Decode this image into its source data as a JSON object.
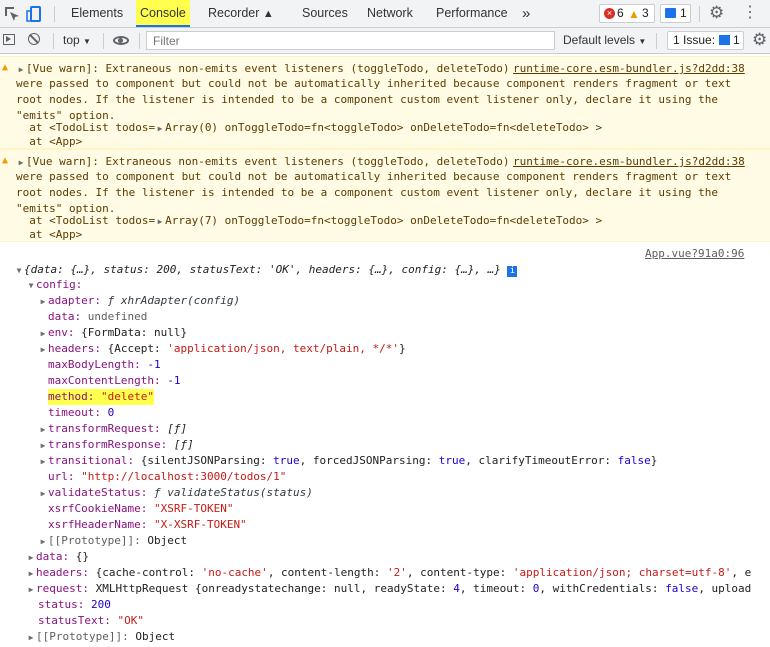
{
  "tabs": {
    "elements": "Elements",
    "console": "Console",
    "recorder": "Recorder",
    "sources": "Sources",
    "network": "Network",
    "performance": "Performance",
    "more": "»"
  },
  "counts": {
    "errors": "6",
    "warnings": "3",
    "messages": "1"
  },
  "toolbar": {
    "context": "top",
    "filter_placeholder": "Filter",
    "levels": "Default levels",
    "issues_label": "1 Issue:",
    "issues_count": "1"
  },
  "warnings": [
    {
      "text": "[Vue warn]: Extraneous non-emits event listeners (toggleTodo, deleteTodo)",
      "link": "runtime-core.esm-bundler.js?d2dd:38",
      "body": "were passed to component but could not be automatically inherited because component renders fragment or text\nroot nodes. If the listener is intended to be a component custom event listener only, declare it using the\n\"emits\" option.",
      "at1_pre": "  at <TodoList todos=",
      "at1_arr": "Array(0)",
      "at1_post": " onToggleTodo=fn<toggleTodo> onDeleteTodo=fn<deleteTodo> >",
      "at2": "  at <App>"
    },
    {
      "text": "[Vue warn]: Extraneous non-emits event listeners (toggleTodo, deleteTodo)",
      "link": "runtime-core.esm-bundler.js?d2dd:38",
      "body": "were passed to component but could not be automatically inherited because component renders fragment or text\nroot nodes. If the listener is intended to be a component custom event listener only, declare it using the\n\"emits\" option.",
      "at1_pre": "  at <TodoList todos=",
      "at1_arr": "Array(7)",
      "at1_post": " onToggleTodo=fn<toggleTodo> onDeleteTodo=fn<deleteTodo> >",
      "at2": "  at <App>"
    }
  ],
  "log": {
    "source": "App.vue?91a0:96",
    "summary": "{data: {…}, status: 200, statusText: 'OK', headers: {…}, config: {…}, …}",
    "info_icon": "i",
    "config_key": "config:",
    "adapter_k": "adapter:",
    "adapter_v": "ƒ xhrAdapter(config)",
    "data_k": "data:",
    "data_v": "undefined",
    "env_k": "env:",
    "env_v": "{FormData: null}",
    "headers_k": "headers:",
    "headers_v1": "{Accept: ",
    "headers_v2": "'application/json, text/plain, */*'",
    "headers_v3": "}",
    "maxBody_k": "maxBodyLength:",
    "maxBody_v": "-1",
    "maxContent_k": "maxContentLength:",
    "maxContent_v": "-1",
    "method_k": "method:",
    "method_v": "\"delete\"",
    "timeout_k": "timeout:",
    "timeout_v": "0",
    "treq_k": "transformRequest:",
    "treq_v": "[ƒ]",
    "tres_k": "transformResponse:",
    "tres_v": "[ƒ]",
    "trans_k": "transitional:",
    "trans_v1": "{silentJSONParsing: ",
    "trans_v2": "true",
    "trans_v3": ", forcedJSONParsing: ",
    "trans_v4": "true",
    "trans_v5": ", clarifyTimeoutError: ",
    "trans_v6": "false",
    "trans_v7": "}",
    "url_k": "url:",
    "url_v": "\"http://localhost:3000/todos/1\"",
    "vstatus_k": "validateStatus:",
    "vstatus_v": "ƒ validateStatus(status)",
    "xcookie_k": "xsrfCookieName:",
    "xcookie_v": "\"XSRF-TOKEN\"",
    "xheader_k": "xsrfHeaderName:",
    "xheader_v": "\"X-XSRF-TOKEN\"",
    "proto1_k": "[[Prototype]]:",
    "proto1_v": "Object",
    "rdata_k": "data:",
    "rdata_v": "{}",
    "rheaders_k": "headers:",
    "rheaders_v1": "{cache-control: ",
    "rheaders_v2": "'no-cache'",
    "rheaders_v3": ", content-length: ",
    "rheaders_v4": "'2'",
    "rheaders_v5": ", content-type: ",
    "rheaders_v6": "'application/json; charset=utf-8'",
    "rheaders_v7": ", e",
    "request_k": "request:",
    "request_v1": "XMLHttpRequest {onreadystatechange: null, readyState: ",
    "request_v2": "4",
    "request_v3": ", timeout: ",
    "request_v4": "0",
    "request_v5": ", withCredentials: ",
    "request_v6": "false",
    "request_v7": ", upload",
    "status_k": "status:",
    "status_v": "200",
    "stext_k": "statusText:",
    "stext_v": "\"OK\"",
    "proto2_k": "[[Prototype]]:",
    "proto2_v": "Object"
  },
  "colors": {
    "accent": "#1a73e8",
    "highlight": "#ffff4d",
    "warn_bg": "#fffbe5",
    "key": "#881280",
    "string": "#c41a16",
    "number": "#1c00cf"
  }
}
